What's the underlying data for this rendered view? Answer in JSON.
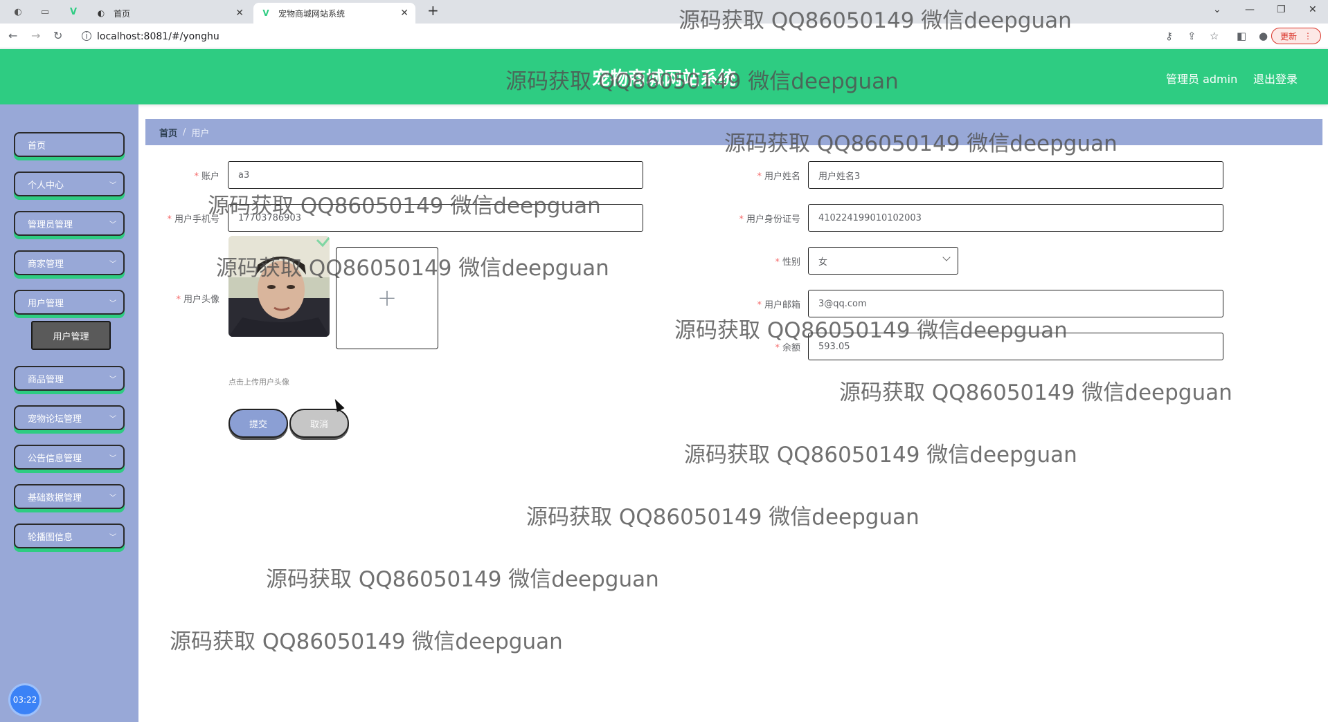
{
  "browser": {
    "tabs": [
      {
        "label": "首页"
      },
      {
        "label": "宠物商城网站系统"
      }
    ],
    "url": "localhost:8081/#/yonghu",
    "update_label": "更新"
  },
  "header": {
    "title": "宠物商城网站系统",
    "admin_label": "管理员 admin",
    "logout_label": "退出登录",
    "accent_color": "#2ecc82"
  },
  "sidebar": {
    "items": [
      {
        "label": "首页",
        "has_arrow": false
      },
      {
        "label": "个人中心",
        "has_arrow": true
      },
      {
        "label": "管理员管理",
        "has_arrow": true
      },
      {
        "label": "商家管理",
        "has_arrow": true
      },
      {
        "label": "用户管理",
        "has_arrow": true
      },
      {
        "label": "商品管理",
        "has_arrow": true
      },
      {
        "label": "宠物论坛管理",
        "has_arrow": true
      },
      {
        "label": "公告信息管理",
        "has_arrow": true
      },
      {
        "label": "基础数据管理",
        "has_arrow": true
      },
      {
        "label": "轮播图信息",
        "has_arrow": true
      }
    ],
    "submenu_active": "用户管理",
    "bg_color": "#98a8d7"
  },
  "breadcrumb": {
    "home": "首页",
    "separator": "/",
    "current": "用户"
  },
  "form": {
    "account": {
      "label": "账户",
      "value": "a3"
    },
    "phone": {
      "label": "用户手机号",
      "value": "17703786903"
    },
    "avatar": {
      "label": "用户头像",
      "upload_tip": "点击上传用户头像",
      "plus": "+"
    },
    "name": {
      "label": "用户姓名",
      "value": "用户姓名3"
    },
    "id_card": {
      "label": "用户身份证号",
      "value": "410224199010102003"
    },
    "gender": {
      "label": "性别",
      "value": "女"
    },
    "email": {
      "label": "用户邮箱",
      "value": "3@qq.com"
    },
    "balance": {
      "label": "余额",
      "value": "593.05"
    },
    "required_mark": "*"
  },
  "buttons": {
    "submit": "提交",
    "cancel": "取消"
  },
  "clock": "03:22",
  "watermark_text": "源码获取 QQ86050149 微信deepguan"
}
